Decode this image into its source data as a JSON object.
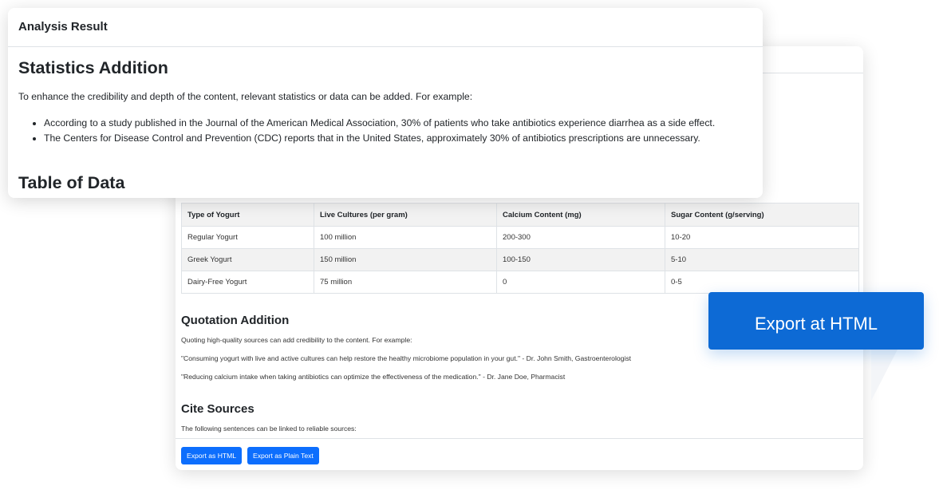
{
  "front": {
    "header_title": "Analysis Result",
    "heading": "Statistics Addition",
    "intro": "To enhance the credibility and depth of the content, relevant statistics or data can be added. For example:",
    "bullets": [
      "According to a study published in the Journal of the American Medical Association, 30% of patients who take antibiotics experience diarrhea as a side effect.",
      "The Centers for Disease Control and Prevention (CDC) reports that in the United States, approximately 30% of antibiotics prescriptions are unnecessary."
    ],
    "table_heading": "Table of Data"
  },
  "table": {
    "headers": [
      "Type of Yogurt",
      "Live Cultures (per gram)",
      "Calcium Content (mg)",
      "Sugar Content (g/serving)"
    ],
    "rows": [
      [
        "Regular Yogurt",
        "100 million",
        "200-300",
        "10-20"
      ],
      [
        "Greek Yogurt",
        "150 million",
        "100-150",
        "5-10"
      ],
      [
        "Dairy-Free Yogurt",
        "75 million",
        "0",
        "0-5"
      ]
    ]
  },
  "quotation": {
    "heading": "Quotation Addition",
    "intro": "Quoting high-quality sources can add credibility to the content. For example:",
    "quote1": "\"Consuming yogurt with live and active cultures can help restore the healthy microbiome population in your gut.\" - Dr. John Smith, Gastroenterologist",
    "quote2": "\"Reducing calcium intake when taking antibiotics can optimize the effectiveness of the medication.\" - Dr. Jane Doe, Pharmacist"
  },
  "cite": {
    "heading": "Cite Sources",
    "intro": "The following sentences can be linked to reliable sources:"
  },
  "footer": {
    "export_html_label": "Export as HTML",
    "export_text_label": "Export as Plain Text"
  },
  "callout": {
    "label": "Export at HTML"
  },
  "colors": {
    "primary_button": "#0d6efd",
    "callout": "#0d6ad5"
  }
}
